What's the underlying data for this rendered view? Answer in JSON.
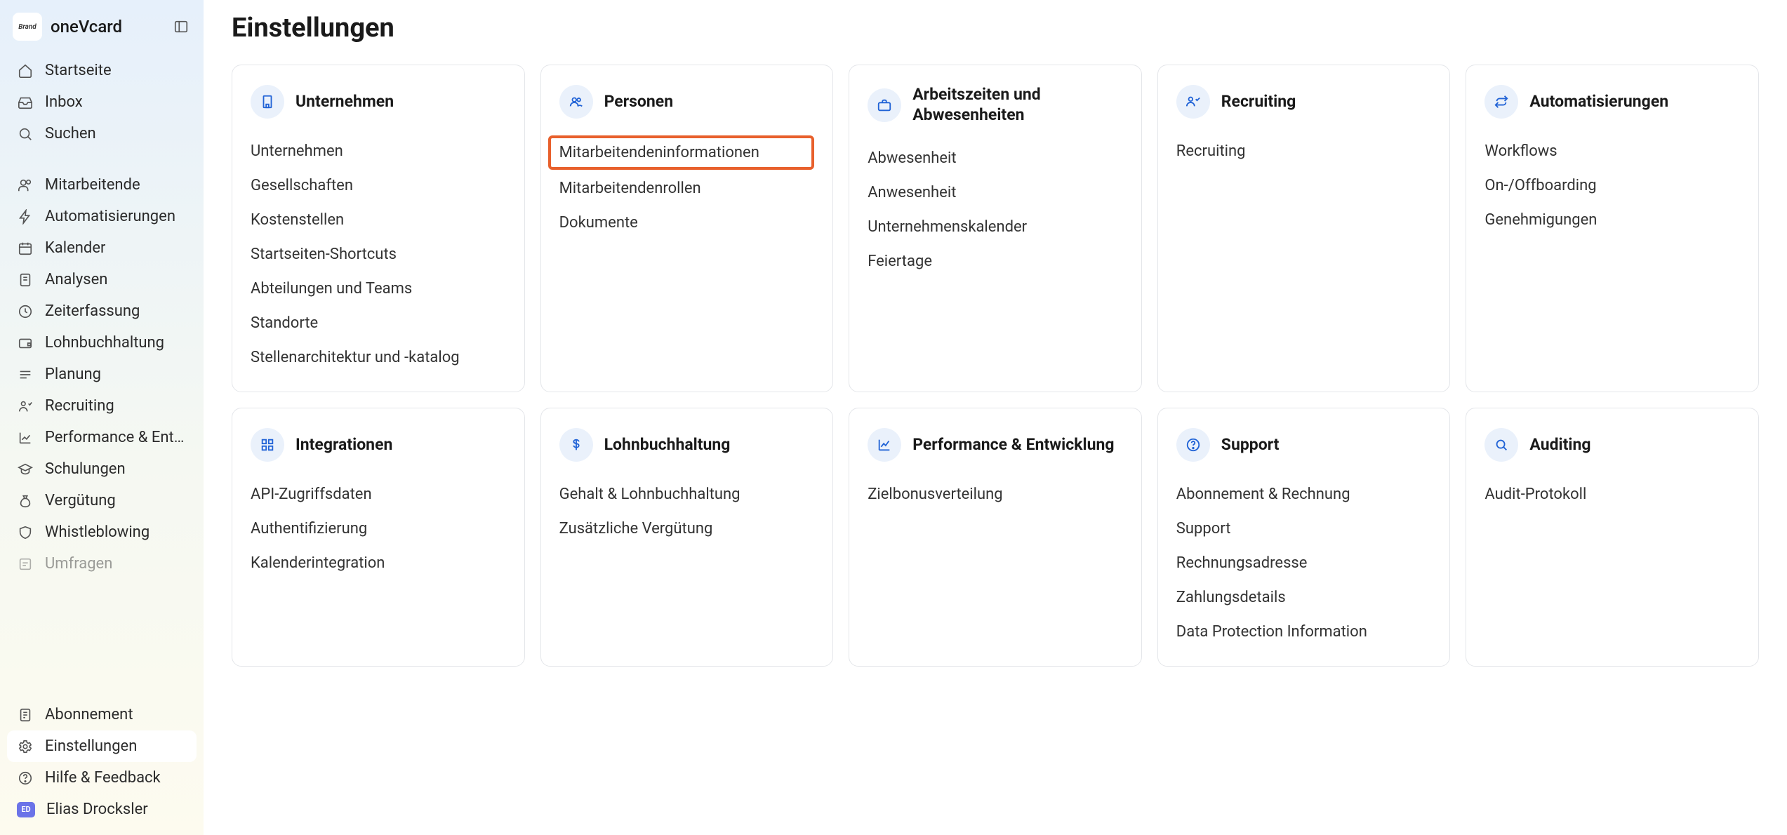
{
  "brand": {
    "badge": "Brand",
    "name": "oneVcard"
  },
  "page": {
    "title": "Einstellungen"
  },
  "nav": {
    "group1": [
      {
        "id": "home",
        "label": "Startseite",
        "icon": "home"
      },
      {
        "id": "inbox",
        "label": "Inbox",
        "icon": "inbox"
      },
      {
        "id": "search",
        "label": "Suchen",
        "icon": "search"
      }
    ],
    "group2": [
      {
        "id": "employees",
        "label": "Mitarbeitende",
        "icon": "users"
      },
      {
        "id": "automations",
        "label": "Automatisierungen",
        "icon": "bolt"
      },
      {
        "id": "calendar",
        "label": "Kalender",
        "icon": "calendar"
      },
      {
        "id": "analyses",
        "label": "Analysen",
        "icon": "document"
      },
      {
        "id": "time",
        "label": "Zeiterfassung",
        "icon": "clock"
      },
      {
        "id": "payroll",
        "label": "Lohnbuchhaltung",
        "icon": "wallet"
      },
      {
        "id": "planning",
        "label": "Planung",
        "icon": "list"
      },
      {
        "id": "recruiting",
        "label": "Recruiting",
        "icon": "recruiting"
      },
      {
        "id": "performance",
        "label": "Performance & Entwi…",
        "icon": "chart"
      },
      {
        "id": "trainings",
        "label": "Schulungen",
        "icon": "cap"
      },
      {
        "id": "compensation",
        "label": "Vergütung",
        "icon": "money"
      },
      {
        "id": "whistle",
        "label": "Whistleblowing",
        "icon": "shield"
      },
      {
        "id": "surveys",
        "label": "Umfragen",
        "icon": "survey"
      }
    ]
  },
  "footer": {
    "subscription": "Abonnement",
    "settings": "Einstellungen",
    "help": "Hilfe & Feedback",
    "user_initials": "ED",
    "user_name": "Elias Drocksler"
  },
  "cards": [
    {
      "id": "company",
      "icon": "building",
      "title": "Unternehmen",
      "links": [
        "Unternehmen",
        "Gesellschaften",
        "Kostenstellen",
        "Startseiten-Shortcuts",
        "Abteilungen und Teams",
        "Standorte",
        "Stellenarchitektur und -katalog"
      ]
    },
    {
      "id": "people",
      "icon": "people",
      "title": "Personen",
      "links": [
        "Mitarbeitendeninformationen",
        "Mitarbeitendenrollen",
        "Dokumente"
      ],
      "highlight_index": 0
    },
    {
      "id": "attendance",
      "icon": "briefcase",
      "title": "Arbeitszeiten und Abwesenheiten",
      "links": [
        "Abwesenheit",
        "Anwesenheit",
        "Unternehmenskalender",
        "Feiertage"
      ]
    },
    {
      "id": "recruiting",
      "icon": "recruiting",
      "title": "Recruiting",
      "links": [
        "Recruiting"
      ]
    },
    {
      "id": "automations",
      "icon": "loop",
      "title": "Automatisierungen",
      "links": [
        "Workflows",
        "On-/Offboarding",
        "Genehmigungen"
      ]
    },
    {
      "id": "integrations",
      "icon": "grid",
      "title": "Integrationen",
      "links": [
        "API-Zugriffsdaten",
        "Authentifizierung",
        "Kalenderintegration"
      ]
    },
    {
      "id": "payroll",
      "icon": "dollar",
      "title": "Lohnbuchhaltung",
      "links": [
        "Gehalt & Lohnbuchhaltung",
        "Zusätzliche Vergütung"
      ]
    },
    {
      "id": "perfdev",
      "icon": "linechart",
      "title": "Performance & Entwicklung",
      "links": [
        "Zielbonusverteilung"
      ]
    },
    {
      "id": "support",
      "icon": "question",
      "title": "Support",
      "links": [
        "Abonnement & Rechnung",
        "Support",
        "Rechnungsadresse",
        "Zahlungsdetails",
        "Data Protection Information"
      ]
    },
    {
      "id": "auditing",
      "icon": "magnify",
      "title": "Auditing",
      "links": [
        "Audit-Protokoll"
      ]
    }
  ]
}
